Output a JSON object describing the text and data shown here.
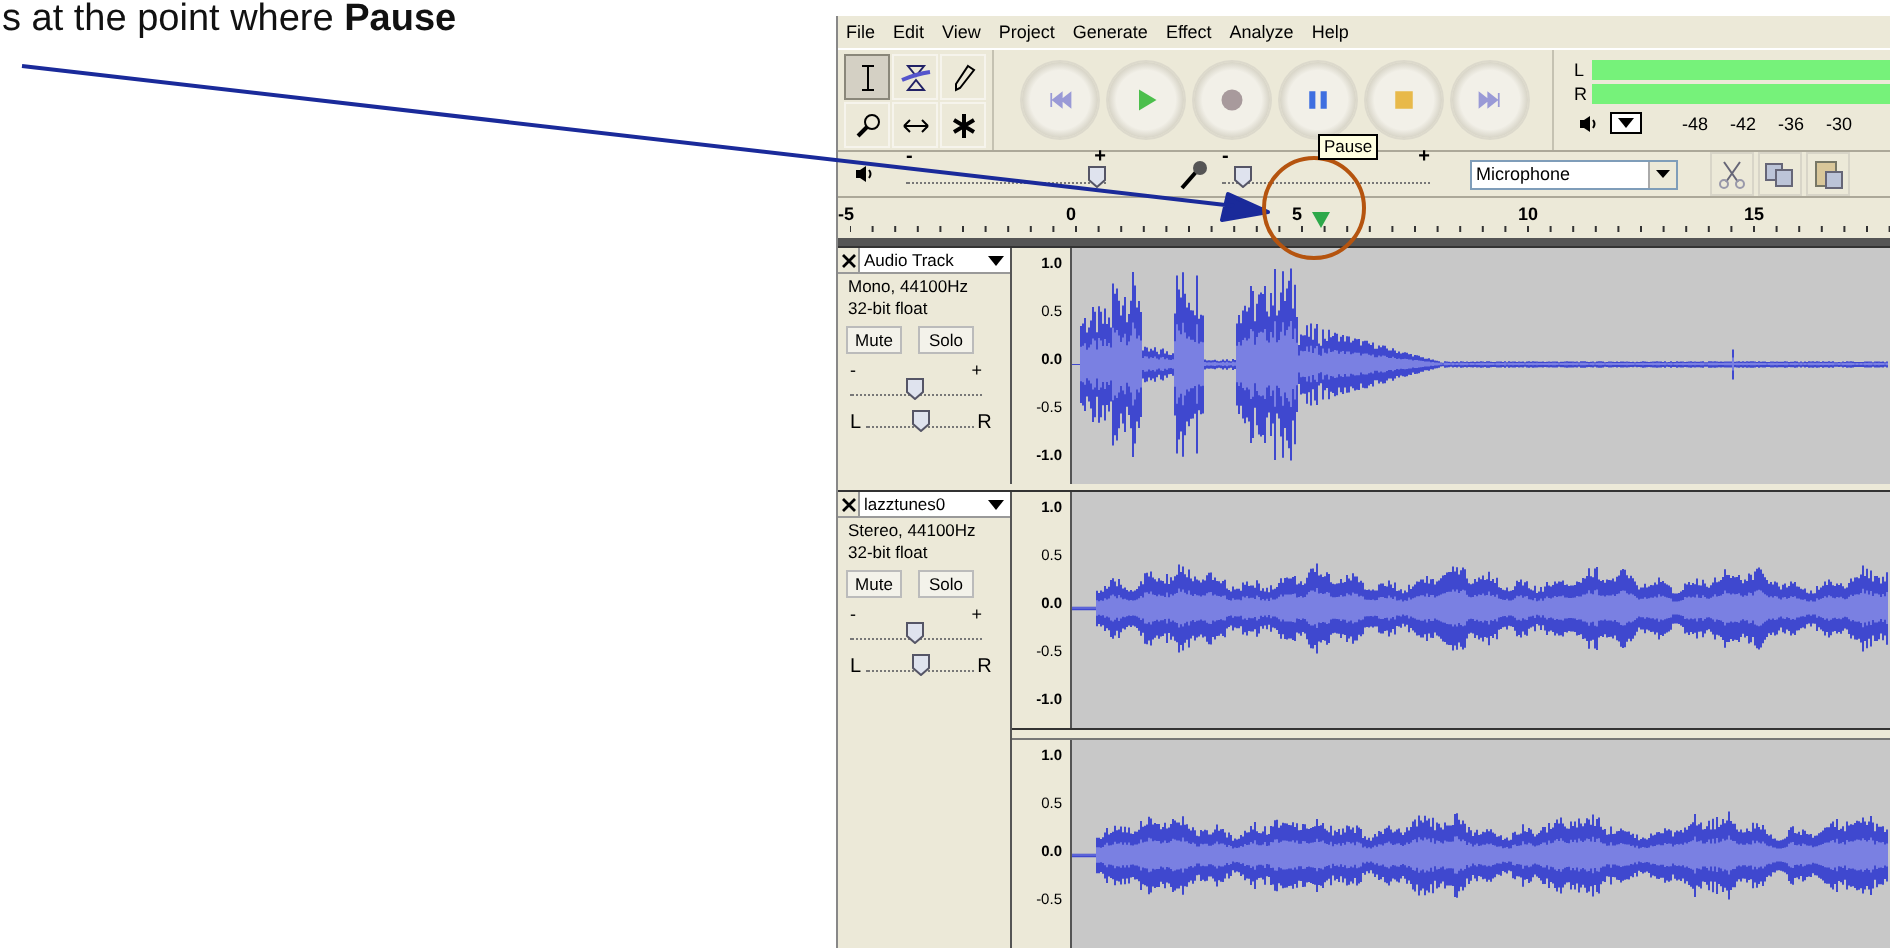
{
  "caption": "s at the point where **Pause**",
  "menu": [
    "File",
    "Edit",
    "View",
    "Project",
    "Generate",
    "Effect",
    "Analyze",
    "Help"
  ],
  "tools": [
    {
      "kind": "select",
      "selected": true
    },
    {
      "kind": "envelope",
      "selected": false
    },
    {
      "kind": "draw",
      "selected": false
    },
    {
      "kind": "zoom",
      "selected": false
    },
    {
      "kind": "timeshift",
      "selected": false
    },
    {
      "kind": "multi",
      "selected": false
    }
  ],
  "transport": [
    {
      "kind": "skip-start"
    },
    {
      "kind": "play"
    },
    {
      "kind": "record"
    },
    {
      "kind": "pause"
    },
    {
      "kind": "stop"
    },
    {
      "kind": "skip-end"
    }
  ],
  "tooltip": "Pause",
  "meter": {
    "channels": [
      {
        "label": "L",
        "level": 1
      },
      {
        "label": "R",
        "level": 1
      }
    ],
    "ticks": [
      "-48",
      "-42",
      "-36",
      "-30"
    ]
  },
  "mixer": {
    "output": {
      "minus": "-",
      "plus": "+",
      "level": 0.95
    },
    "input": {
      "minus": "-",
      "plus": "+",
      "level": 0.1
    },
    "source": "Microphone"
  },
  "edit_tools": [
    {
      "kind": "cut"
    },
    {
      "kind": "copy"
    },
    {
      "kind": "paste"
    }
  ],
  "ruler": {
    "ticks": [
      "-5",
      "0",
      "5",
      "10",
      "15"
    ]
  },
  "tracks": [
    {
      "name": "Audio Track",
      "info": [
        "Mono, 44100Hz",
        "32-bit float"
      ],
      "buttons": [
        "Mute",
        "Solo"
      ],
      "gain": {
        "minus": "-",
        "plus": "+",
        "level": 0.49
      },
      "pan": {
        "left": "L",
        "right": "R",
        "level": 0.5
      },
      "channels": [
        {
          "kind": "speech",
          "scale": [
            "1.0",
            "0.5",
            "0.0",
            "-0.5",
            "-1.0"
          ]
        }
      ]
    },
    {
      "name": "lazztunes0",
      "info": [
        "Stereo, 44100Hz",
        "32-bit float"
      ],
      "buttons": [
        "Mute",
        "Solo"
      ],
      "gain": {
        "minus": "-",
        "plus": "+",
        "level": 0.49
      },
      "pan": {
        "left": "L",
        "right": "R",
        "level": 0.5
      },
      "channels": [
        {
          "kind": "music",
          "scale": [
            "1.0",
            "0.5",
            "0.0",
            "-0.5",
            "-1.0"
          ]
        },
        {
          "kind": "music",
          "scale": [
            "1.0",
            "0.5",
            "0.0",
            "-0.5"
          ]
        }
      ]
    }
  ]
}
